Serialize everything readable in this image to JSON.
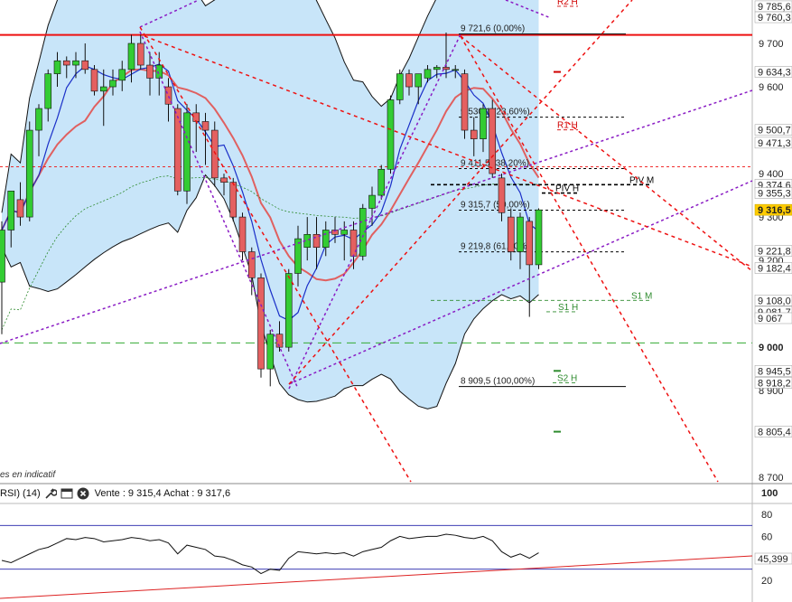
{
  "indicator_bar": {
    "rsi_label": "RSI) (14)",
    "sell_label": "Vente : 9 315,4 Achat : 9 317,6",
    "watermark": "es en indicatif"
  },
  "price_axis": {
    "ticks": [
      "9 700",
      "9 600",
      "9 500",
      "9 400",
      "9 300",
      "9 200",
      "9 100",
      "9 000",
      "8 900",
      "8 800",
      "8 700"
    ],
    "tick_values": [
      9700,
      9600,
      9500,
      9400,
      9300,
      9200,
      9100,
      9000,
      8900,
      8800,
      8700
    ],
    "bold_tick": "9 000",
    "labels": [
      {
        "text": "9 785,6",
        "value": 9785.6,
        "color": "#d00000"
      },
      {
        "text": "9 760,3",
        "value": 9760.3,
        "color": "#000000"
      },
      {
        "text": "9 634,3",
        "value": 9634.3,
        "color": "#d00000"
      },
      {
        "text": "9 500,7",
        "value": 9500.7,
        "color": "#d00000"
      },
      {
        "text": "9 471,3",
        "value": 9471.3,
        "color": "#d0504a"
      },
      {
        "text": "9 374,6",
        "value": 9374.6,
        "color": "#000000"
      },
      {
        "text": "9 355,3",
        "value": 9355.3,
        "color": "#2e8b2e"
      },
      {
        "text": "9 316,5",
        "value": 9316.5,
        "color": "#000000",
        "highlight": "#ffcc00"
      },
      {
        "text": "9 221,8",
        "value": 9221.8,
        "color": "#000000"
      },
      {
        "text": "9 182,4",
        "value": 9182.4,
        "color": "#000000"
      },
      {
        "text": "9 108,0",
        "value": 9108.0,
        "color": "#2e8b2e"
      },
      {
        "text": "9 081,7",
        "value": 9081.7,
        "color": "#2e8b2e"
      },
      {
        "text": "9 067",
        "value": 9067.0,
        "color": "#2e8b2e"
      },
      {
        "text": "8 945,5",
        "value": 8945.5,
        "color": "#2e8b2e"
      },
      {
        "text": "8 918,2",
        "value": 8918.2,
        "color": "#2e8b2e"
      },
      {
        "text": "8 805,4",
        "value": 8805.4,
        "color": "#2e8b2e"
      }
    ]
  },
  "rsi_axis": {
    "ticks": [
      "100",
      "80",
      "60",
      "40",
      "20"
    ],
    "tick_values": [
      100,
      80,
      60,
      40,
      20
    ],
    "current": "45,399"
  },
  "levels": {
    "fib": [
      {
        "text": "9 721,6 (0,00%)",
        "value": 9721.6
      },
      {
        "text": "9 530,1 (23,60%)",
        "value": 9530.1
      },
      {
        "text": "9 411,5 (38,20%)",
        "value": 9411.5
      },
      {
        "text": "9 315,7 (50,00%)",
        "value": 9315.7
      },
      {
        "text": "9 219,8 (61,80%)",
        "value": 9219.8
      },
      {
        "text": "8 909,5 (100,00%)",
        "value": 8909.5
      }
    ],
    "pivots": [
      {
        "text": "R2 H",
        "value": 9785.6,
        "color": "#d00000"
      },
      {
        "text": "R1 H",
        "value": 9500.7,
        "color": "#d00000"
      },
      {
        "text": "PIV M",
        "value": 9374.6,
        "color": "#000000"
      },
      {
        "text": "PIV H",
        "value": 9355.3,
        "color": "#000000"
      },
      {
        "text": "S1 M",
        "value": 9108.0,
        "color": "#2e8b2e"
      },
      {
        "text": "S1 H",
        "value": 9081.7,
        "color": "#2e8b2e"
      },
      {
        "text": "S2 H",
        "value": 8918.2,
        "color": "#2e8b2e"
      }
    ]
  },
  "colors": {
    "up": "#33cc33",
    "down": "#e46060",
    "band_fill": "#b5dcf7",
    "fib_ema": "#e06060",
    "sma": "#1a2fc8",
    "long_ma": "#2e8b2e",
    "purple": "#8a1cc4",
    "red_dash": "#ee1111"
  },
  "chart_data": {
    "type": "candlestick",
    "ylim": [
      8690,
      9800
    ],
    "candles": [
      {
        "o": 9150,
        "h": 9290,
        "l": 9030,
        "c": 9270
      },
      {
        "o": 9270,
        "h": 9360,
        "l": 9230,
        "c": 9360
      },
      {
        "o": 9340,
        "h": 9380,
        "l": 9280,
        "c": 9300
      },
      {
        "o": 9300,
        "h": 9520,
        "l": 9290,
        "c": 9500
      },
      {
        "o": 9500,
        "h": 9560,
        "l": 9440,
        "c": 9550
      },
      {
        "o": 9550,
        "h": 9640,
        "l": 9520,
        "c": 9630
      },
      {
        "o": 9630,
        "h": 9680,
        "l": 9600,
        "c": 9660
      },
      {
        "o": 9660,
        "h": 9670,
        "l": 9620,
        "c": 9650
      },
      {
        "o": 9650,
        "h": 9680,
        "l": 9620,
        "c": 9660
      },
      {
        "o": 9660,
        "h": 9700,
        "l": 9630,
        "c": 9640
      },
      {
        "o": 9640,
        "h": 9650,
        "l": 9580,
        "c": 9590
      },
      {
        "o": 9590,
        "h": 9640,
        "l": 9510,
        "c": 9600
      },
      {
        "o": 9600,
        "h": 9640,
        "l": 9580,
        "c": 9615
      },
      {
        "o": 9615,
        "h": 9660,
        "l": 9590,
        "c": 9640
      },
      {
        "o": 9640,
        "h": 9720,
        "l": 9610,
        "c": 9700
      },
      {
        "o": 9700,
        "h": 9720,
        "l": 9640,
        "c": 9650
      },
      {
        "o": 9650,
        "h": 9680,
        "l": 9580,
        "c": 9620
      },
      {
        "o": 9620,
        "h": 9680,
        "l": 9580,
        "c": 9650
      },
      {
        "o": 9600,
        "h": 9620,
        "l": 9520,
        "c": 9560
      },
      {
        "o": 9550,
        "h": 9560,
        "l": 9350,
        "c": 9360
      },
      {
        "o": 9360,
        "h": 9560,
        "l": 9330,
        "c": 9540
      },
      {
        "o": 9540,
        "h": 9560,
        "l": 9450,
        "c": 9520
      },
      {
        "o": 9520,
        "h": 9540,
        "l": 9420,
        "c": 9500
      },
      {
        "o": 9500,
        "h": 9520,
        "l": 9370,
        "c": 9390
      },
      {
        "o": 9390,
        "h": 9400,
        "l": 9350,
        "c": 9380
      },
      {
        "o": 9380,
        "h": 9390,
        "l": 9290,
        "c": 9300
      },
      {
        "o": 9300,
        "h": 9310,
        "l": 9200,
        "c": 9220
      },
      {
        "o": 9220,
        "h": 9230,
        "l": 9120,
        "c": 9160
      },
      {
        "o": 9160,
        "h": 9170,
        "l": 8930,
        "c": 8950
      },
      {
        "o": 8950,
        "h": 9040,
        "l": 8910,
        "c": 9030
      },
      {
        "o": 9030,
        "h": 9060,
        "l": 8990,
        "c": 9000
      },
      {
        "o": 9000,
        "h": 9180,
        "l": 8990,
        "c": 9170
      },
      {
        "o": 9170,
        "h": 9280,
        "l": 9140,
        "c": 9250
      },
      {
        "o": 9230,
        "h": 9300,
        "l": 9200,
        "c": 9260
      },
      {
        "o": 9260,
        "h": 9300,
        "l": 9180,
        "c": 9230
      },
      {
        "o": 9230,
        "h": 9290,
        "l": 9210,
        "c": 9270
      },
      {
        "o": 9270,
        "h": 9300,
        "l": 9240,
        "c": 9260
      },
      {
        "o": 9260,
        "h": 9290,
        "l": 9200,
        "c": 9270
      },
      {
        "o": 9270,
        "h": 9290,
        "l": 9180,
        "c": 9210
      },
      {
        "o": 9210,
        "h": 9330,
        "l": 9200,
        "c": 9320
      },
      {
        "o": 9320,
        "h": 9370,
        "l": 9280,
        "c": 9350
      },
      {
        "o": 9350,
        "h": 9420,
        "l": 9340,
        "c": 9410
      },
      {
        "o": 9410,
        "h": 9580,
        "l": 9400,
        "c": 9570
      },
      {
        "o": 9570,
        "h": 9640,
        "l": 9560,
        "c": 9630
      },
      {
        "o": 9630,
        "h": 9640,
        "l": 9580,
        "c": 9600
      },
      {
        "o": 9600,
        "h": 9630,
        "l": 9560,
        "c": 9630
      },
      {
        "o": 9620,
        "h": 9650,
        "l": 9610,
        "c": 9640
      },
      {
        "o": 9640,
        "h": 9650,
        "l": 9620,
        "c": 9645
      },
      {
        "o": 9645,
        "h": 9725,
        "l": 9620,
        "c": 9640
      },
      {
        "o": 9640,
        "h": 9650,
        "l": 9620,
        "c": 9640
      },
      {
        "o": 9630,
        "h": 9640,
        "l": 9480,
        "c": 9500
      },
      {
        "o": 9500,
        "h": 9530,
        "l": 9440,
        "c": 9480
      },
      {
        "o": 9480,
        "h": 9560,
        "l": 9450,
        "c": 9550
      },
      {
        "o": 9550,
        "h": 9570,
        "l": 9390,
        "c": 9400
      },
      {
        "o": 9390,
        "h": 9400,
        "l": 9290,
        "c": 9310
      },
      {
        "o": 9300,
        "h": 9320,
        "l": 9200,
        "c": 9220
      },
      {
        "o": 9220,
        "h": 9310,
        "l": 9180,
        "c": 9300
      },
      {
        "o": 9290,
        "h": 9300,
        "l": 9070,
        "c": 9190
      },
      {
        "o": 9190,
        "h": 9320,
        "l": 9180,
        "c": 9316.5
      }
    ],
    "rsi": [
      38,
      36,
      40,
      44,
      48,
      50,
      54,
      58,
      57,
      59,
      58,
      55,
      56,
      57,
      59,
      58,
      56,
      57,
      54,
      44,
      52,
      50,
      48,
      42,
      41,
      38,
      34,
      32,
      26,
      30,
      29,
      40,
      46,
      45,
      44,
      45,
      44,
      45,
      42,
      46,
      48,
      50,
      56,
      60,
      58,
      59,
      60,
      60,
      62,
      61,
      59,
      58,
      60,
      56,
      46,
      41,
      44,
      40,
      45
    ]
  }
}
